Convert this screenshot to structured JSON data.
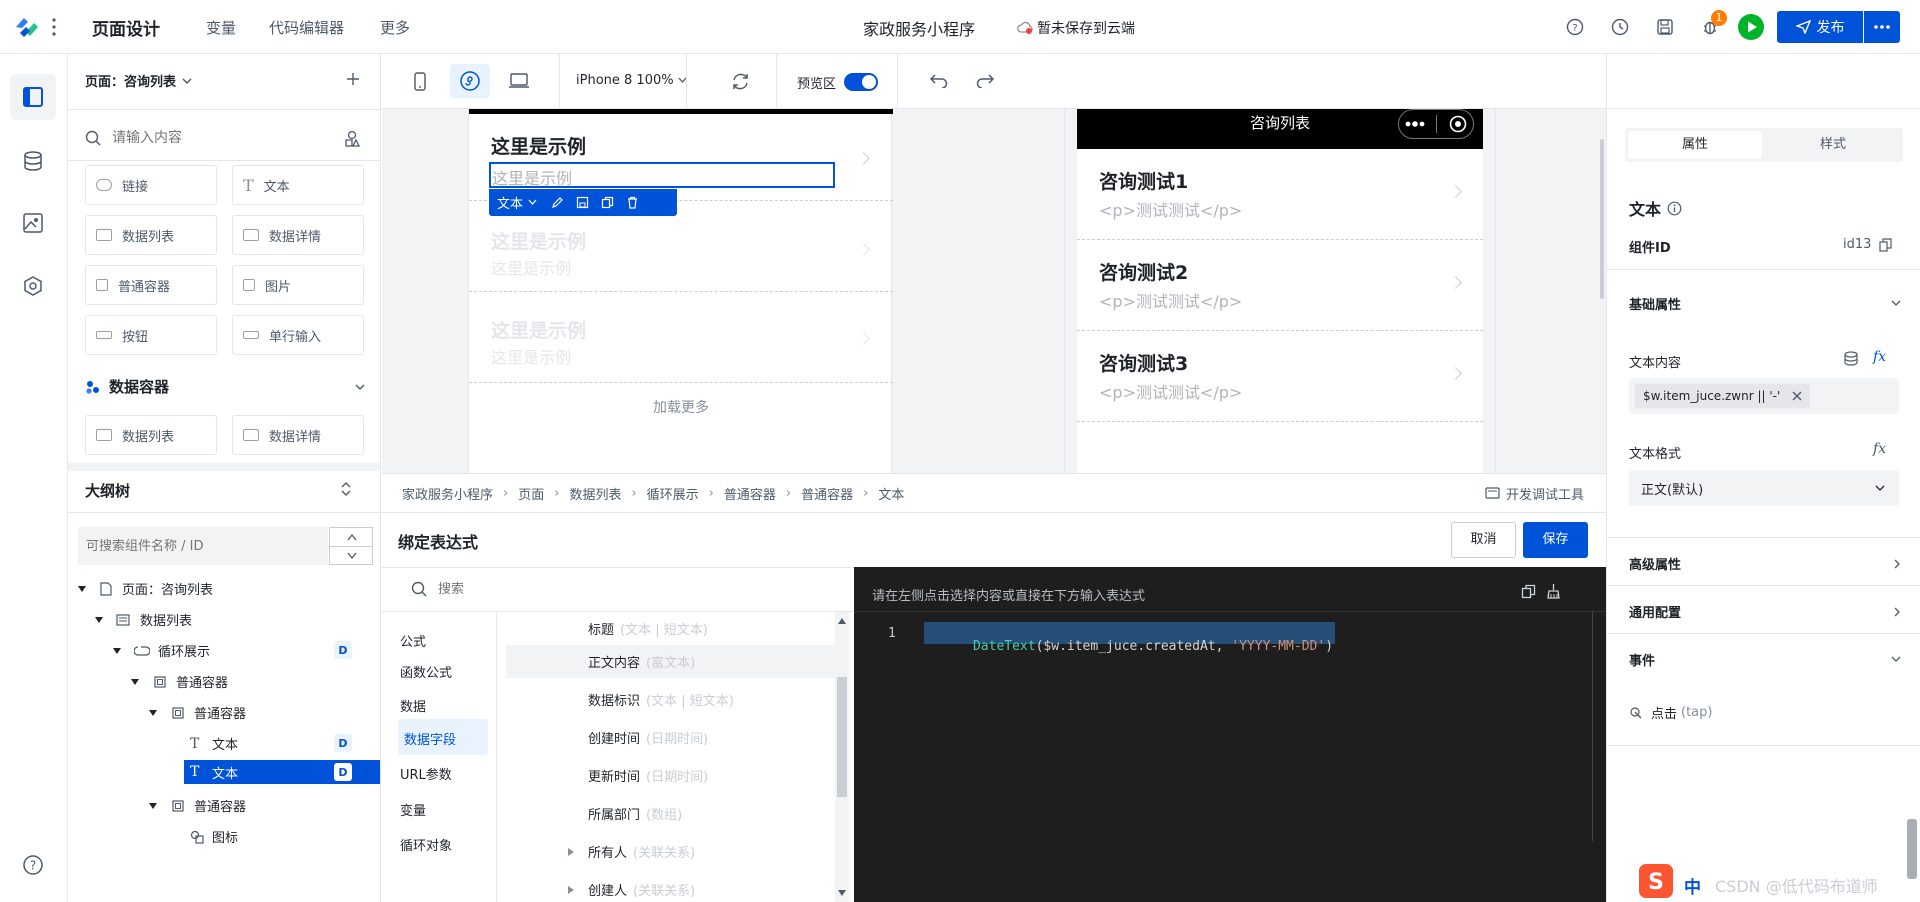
{
  "topbar": {
    "page_design": "页面设计",
    "menu": [
      "变量",
      "代码编辑器",
      "更多"
    ],
    "app_title": "家政服务小程序",
    "save_status": "暂未保存到云端",
    "notification_count": "1",
    "publish_label": "发布"
  },
  "left_panel": {
    "page_selector": "页面：咨询列表",
    "search_placeholder": "请输入内容",
    "components": [
      "链接",
      "文本",
      "数据列表",
      "数据详情",
      "普通容器",
      "图片",
      "按钮",
      "单行输入"
    ],
    "data_container_title": "数据容器",
    "data_components": [
      "数据列表",
      "数据详情"
    ],
    "outline_title": "大纲树",
    "outline_search_placeholder": "可搜索组件名称 / ID",
    "tree": [
      {
        "label": "页面：咨询列表",
        "badge": ""
      },
      {
        "label": "数据列表",
        "badge": ""
      },
      {
        "label": "循环展示",
        "badge": "D"
      },
      {
        "label": "普通容器",
        "badge": ""
      },
      {
        "label": "普通容器",
        "badge": ""
      },
      {
        "label": "文本",
        "badge": "D"
      },
      {
        "label": "文本",
        "badge": "D"
      },
      {
        "label": "普通容器",
        "badge": ""
      },
      {
        "label": "图标",
        "badge": ""
      }
    ]
  },
  "toolbar": {
    "device": "iPhone 8 100%",
    "preview_label": "预览区",
    "preview_on": true
  },
  "canvas": {
    "left_items": [
      {
        "title": "这里是示例",
        "sub": "这里是示例"
      },
      {
        "title": "这里是示例",
        "sub": "这里是示例"
      },
      {
        "title": "这里是示例",
        "sub": "这里是示例"
      }
    ],
    "load_more": "加载更多",
    "selected_tag": "文本",
    "preview_title": "咨询列表",
    "preview_items": [
      {
        "title": "咨询测试1",
        "sub": "<p>测试测试</p>"
      },
      {
        "title": "咨询测试2",
        "sub": "<p>测试测试</p>"
      },
      {
        "title": "咨询测试3",
        "sub": "<p>测试测试</p>"
      }
    ]
  },
  "breadcrumb": [
    "家政服务小程序",
    "页面",
    "数据列表",
    "循环展示",
    "普通容器",
    "普通容器",
    "文本"
  ],
  "devtools_label": "开发调试工具",
  "binding": {
    "title": "绑定表达式",
    "cancel": "取消",
    "save": "保存",
    "search_placeholder": "搜索",
    "categories": [
      {
        "label": "公式",
        "type": "heading"
      },
      {
        "label": "函数公式",
        "type": "item"
      },
      {
        "label": "数据",
        "type": "heading"
      },
      {
        "label": "数据字段",
        "type": "active"
      },
      {
        "label": "URL参数",
        "type": "item"
      },
      {
        "label": "变量",
        "type": "item"
      },
      {
        "label": "循环对象",
        "type": "item"
      }
    ],
    "fields": [
      {
        "name": "标题",
        "type": "(文本 | 短文本)"
      },
      {
        "name": "正文内容",
        "type": "(富文本)"
      },
      {
        "name": "数据标识",
        "type": "(文本 | 短文本)"
      },
      {
        "name": "创建时间",
        "type": "(日期时间)"
      },
      {
        "name": "更新时间",
        "type": "(日期时间)"
      },
      {
        "name": "所属部门",
        "type": "(数组)"
      },
      {
        "name": "所有人",
        "type": "(关联关系)"
      },
      {
        "name": "创建人",
        "type": "(关联关系)"
      }
    ],
    "editor_hint": "请在左侧点击选择内容或直接在下方输入表达式",
    "line_number": "1",
    "code_fn": "DateText",
    "code_open": "(",
    "code_arg": "$w.item_juce.createdAt,",
    "code_str": "'YYYY-MM-DD'",
    "code_close": ")"
  },
  "right_panel": {
    "tabs": [
      "属性",
      "样式"
    ],
    "component_name": "文本",
    "component_id_label": "组件ID",
    "component_id": "id13",
    "basic_props": "基础属性",
    "text_content_label": "文本内容",
    "text_content_value": "$w.item_juce.zwnr || '-'",
    "text_format_label": "文本格式",
    "text_format_value": "正文(默认)",
    "advanced_props": "高级属性",
    "common_config": "通用配置",
    "events": "事件",
    "event_click": "点击",
    "event_tap": "(tap)"
  },
  "watermark": {
    "text": "CSDN @低代码布道师",
    "ime": "中"
  },
  "colors": {
    "primary": "#0052d9",
    "selection": "#264f78",
    "editor_bg": "#1e1e1e"
  }
}
